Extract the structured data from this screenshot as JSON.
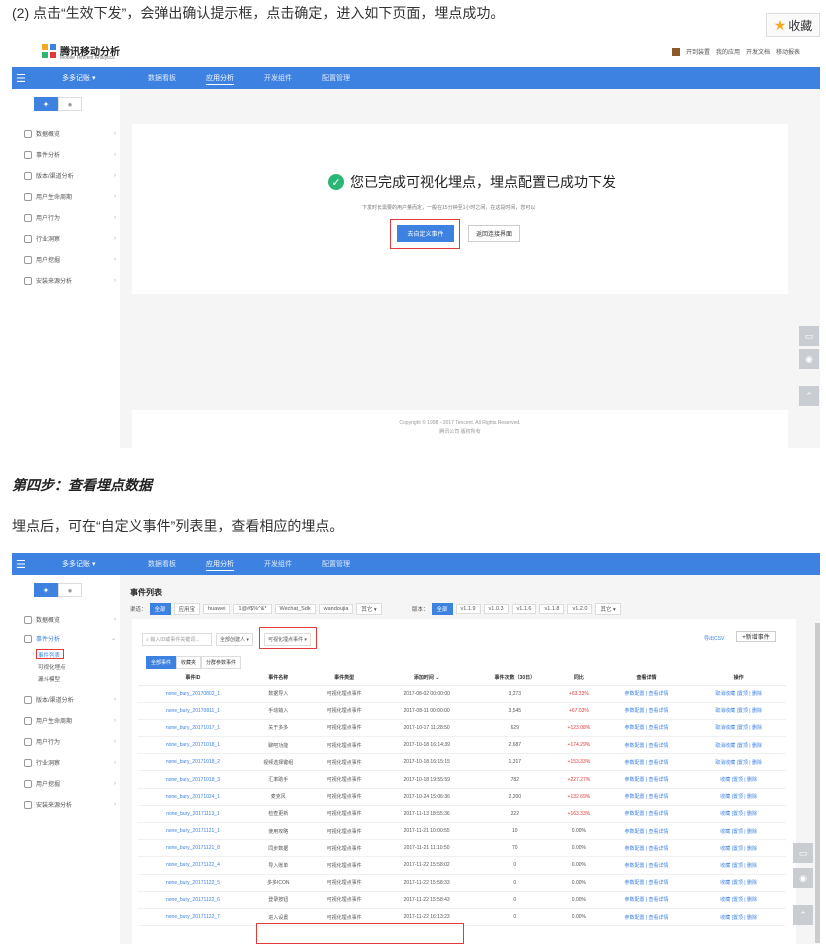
{
  "step_text": "(2) 点击“生效下发”，会弹出确认提示框，点击确定，进入如下页面，埋点成功。",
  "favorite_label": "收藏",
  "section_heading": "第四步：查看埋点数据",
  "body_text": "埋点后，可在“自定义事件”列表里，查看相应的埋点。",
  "app": {
    "logo_title": "腾讯移动分析",
    "logo_sub": "Mobile Tencent Analytics",
    "top_links": [
      "开到装置",
      "我的应用",
      "开发文档",
      "移动报表"
    ],
    "app_name": "多多记账 ▾",
    "nav": [
      "数据看板",
      "应用分析",
      "开发组件",
      "配置管理"
    ],
    "nav_active": "应用分析",
    "sidebar": [
      "数据概览",
      "事件分析",
      "版本/渠道分析",
      "用户生命周期",
      "用户行为",
      "行业洞察",
      "用户挖掘",
      "安装来源分析"
    ],
    "sidebar_sub": [
      "事件列表",
      "可视化埋点",
      "漏斗模型"
    ]
  },
  "success": {
    "message": "您已完成可视化埋点，埋点配置已成功下发",
    "hint": "下发时长需要的用户量而定，一般在15分钟至1小时之间，在这段时间，您可以",
    "primary_button": "去自定义事件",
    "secondary_button": "返回连接界面"
  },
  "copyright_line1": "Copyright © 1998 - 2017 Tencent. All Rights Reserved.",
  "copyright_line2": "腾讯公司 版权所有",
  "events": {
    "title": "事件列表",
    "channel_label": "渠道：",
    "channels": [
      "全部",
      "应用宝",
      "huawei",
      "1@#$%^&*",
      "Wechat_Sdk",
      "wandoujia",
      "其它 ▾"
    ],
    "version_label": "版本：",
    "versions": [
      "全部",
      "v1.1.9",
      "v1.0.3",
      "v1.1.6",
      "v1.1.8",
      "v1.2.0",
      "其它 ▾"
    ],
    "search_placeholder": "输入ID或事件关键词...",
    "creator_filter": "全部创建人 ▾",
    "type_filter": "可视化埋点事件 ▾",
    "export": "导出CSV",
    "new_event": "+新增事件",
    "tabs": [
      "全部事件",
      "收藏夹",
      "分群参数事件"
    ],
    "columns": [
      "事件ID",
      "事件名称",
      "事件类型",
      "添加时间 ⌄",
      "事件次数（30日）",
      "同比",
      "查看详情",
      "操作"
    ],
    "rows": [
      [
        "none_bury_20170802_1",
        "数据导入",
        "可视化埋点事件",
        "2017-08-02 00:00:00",
        "3,273",
        "+63.33%",
        "参数配置 | 查看详情",
        "取消收藏 |置顶 | 删除"
      ],
      [
        "none_bury_20170811_1",
        "手动输入",
        "可视化埋点事件",
        "2017-08-11 00:00:00",
        "3,545",
        "+67.03%",
        "参数配置 | 查看详情",
        "取消收藏 |置顶 | 删除"
      ],
      [
        "none_bury_20171017_1",
        "关于多多",
        "可视化埋点事件",
        "2017-10-17 11:28:50",
        "629",
        "+123.08%",
        "参数配置 | 查看详情",
        "取消收藏 |置顶 | 删除"
      ],
      [
        "none_bury_20171018_1",
        "聊吧功能",
        "可视化埋点事件",
        "2017-10-18 16:14:39",
        "2,687",
        "+174.29%",
        "参数配置 | 查看详情",
        "取消收藏 |置顶 | 删除"
      ],
      [
        "none_bury_20171018_2",
        "视频选择键组",
        "可视化埋点事件",
        "2017-10-18 16:15:15",
        "1,317",
        "+153.33%",
        "参数配置 | 查看详情",
        "取消收藏 |置顶 | 删除"
      ],
      [
        "none_bury_20171018_3",
        "汇率助手",
        "可视化埋点事件",
        "2017-10-18 19:55:59",
        "782",
        "+227.27%",
        "参数配置 | 查看详情",
        "收藏 |置顶 | 删除"
      ],
      [
        "none_bury_20171024_1",
        "麦克风",
        "可视化埋点事件",
        "2017-10-24 15:06:36",
        "2,200",
        "+132.69%",
        "参数配置 | 查看详情",
        "收藏 |置顶 | 删除"
      ],
      [
        "none_bury_20171113_1",
        "检查更新",
        "可视化埋点事件",
        "2017-11-13 18:55:36",
        "222",
        "+163.33%",
        "参数配置 | 查看详情",
        "收藏 |置顶 | 删除"
      ],
      [
        "none_bury_20171121_1",
        "使用攻略",
        "可视化埋点事件",
        "2017-11-21 10:00:55",
        "10",
        "0.00%",
        "参数配置 | 查看详情",
        "收藏 |置顶 | 删除"
      ],
      [
        "none_bury_20171121_8",
        "同步数据",
        "可视化埋点事件",
        "2017-11-21 11:10:50",
        "70",
        "0.00%",
        "参数配置 | 查看详情",
        "收藏 |置顶 | 删除"
      ],
      [
        "none_bury_20171122_4",
        "导入账单",
        "可视化埋点事件",
        "2017-11-22 15:58:02",
        "0",
        "0.00%",
        "参数配置 | 查看详情",
        "收藏 |置顶 | 删除"
      ],
      [
        "none_bury_20171122_5",
        "多多ICON",
        "可视化埋点事件",
        "2017-11-22 15:58:33",
        "0",
        "0.00%",
        "参数配置 | 查看详情",
        "收藏 |置顶 | 删除"
      ],
      [
        "none_bury_20171122_6",
        "登录按钮",
        "可视化埋点事件",
        "2017-11-22 15:58:43",
        "0",
        "0.00%",
        "参数配置 | 查看详情",
        "收藏 |置顶 | 删除"
      ],
      [
        "none_bury_20171122_7",
        "进入设置",
        "可视化埋点事件",
        "2017-11-22 16:13:23",
        "0",
        "0.00%",
        "参数配置 | 查看详情",
        "收藏 |置顶 | 删除"
      ]
    ]
  },
  "colors": {
    "accent": "#3d82e0",
    "highlight": "#e23a3a",
    "success": "#2bb673"
  }
}
